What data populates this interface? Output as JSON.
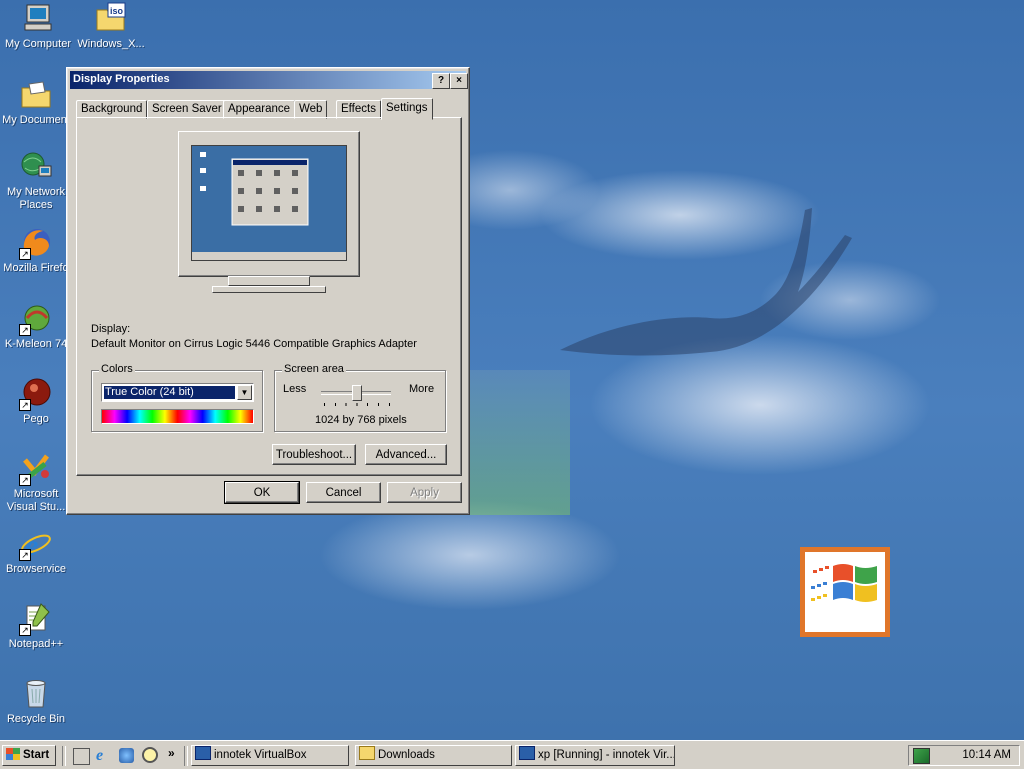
{
  "desktop": {
    "icons": [
      {
        "label": "My Computer",
        "icon": "my-computer-icon"
      },
      {
        "label": "Windows_X...",
        "icon": "iso-folder-icon"
      },
      {
        "label": "My Document",
        "icon": "my-documents-icon"
      },
      {
        "label": "My Network",
        "label2": "Places",
        "icon": "network-places-icon"
      },
      {
        "label": "Mozilla Firefo",
        "icon": "firefox-icon"
      },
      {
        "label": "K-Meleon 74",
        "icon": "k-meleon-icon"
      },
      {
        "label": "Pego",
        "icon": "pego-icon"
      },
      {
        "label": "Microsoft",
        "label2": "Visual Stu...",
        "icon": "visual-studio-icon"
      },
      {
        "label": "Browservice",
        "icon": "internet-explorer-icon"
      },
      {
        "label": "Notepad++",
        "icon": "notepad-plus-plus-icon"
      },
      {
        "label": "Recycle Bin",
        "icon": "recycle-bin-icon"
      }
    ],
    "iso_badge": "iso"
  },
  "dialog": {
    "title": "Display Properties",
    "help_button": "?",
    "close_button": "×",
    "tabs": [
      "Background",
      "Screen Saver",
      "Appearance",
      "Web",
      "Effects",
      "Settings"
    ],
    "active_tab": "Settings",
    "display_label": "Display:",
    "display_value": "Default Monitor on Cirrus Logic 5446 Compatible Graphics Adapter",
    "colors": {
      "legend": "Colors",
      "selected": "True Color (24 bit)"
    },
    "screen_area": {
      "legend": "Screen area",
      "less": "Less",
      "more": "More",
      "value": "1024 by 768 pixels",
      "slider_position": 0.5
    },
    "buttons": {
      "troubleshoot": "Troubleshoot...",
      "advanced": "Advanced...",
      "ok": "OK",
      "cancel": "Cancel",
      "apply": "Apply"
    }
  },
  "taskbar": {
    "start": "Start",
    "items": [
      {
        "label": "innotek VirtualBox",
        "icon": "virtualbox-icon"
      },
      {
        "label": "Downloads",
        "icon": "folder-icon"
      },
      {
        "label": "xp [Running] - innotek Vir...",
        "icon": "virtualbox-icon"
      }
    ],
    "overflow": "»",
    "clock": "10:14 AM"
  },
  "colors": {
    "titlebar_start": "#0a246a",
    "titlebar_end": "#a6caf0",
    "face": "#d4d0c8",
    "desktop": "#3a6ea5"
  }
}
